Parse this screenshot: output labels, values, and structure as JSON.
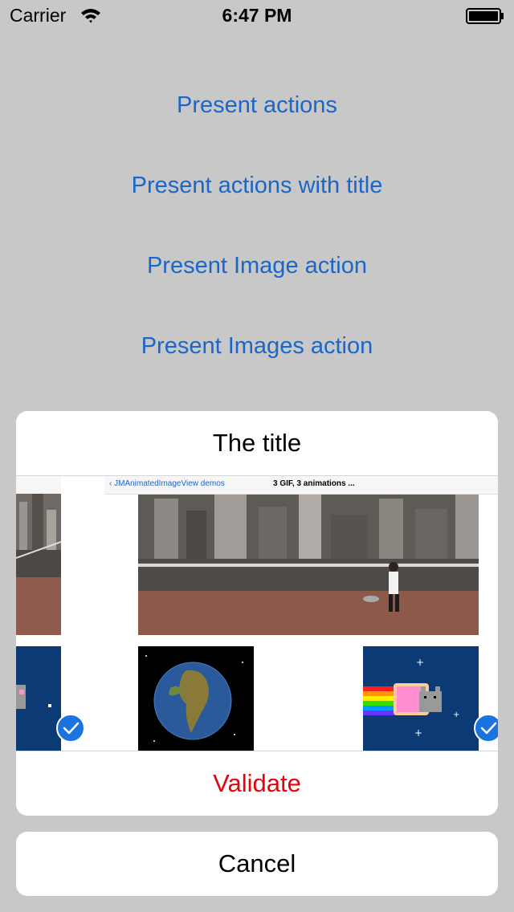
{
  "status_bar": {
    "carrier": "Carrier",
    "time": "6:47 PM",
    "wifi_icon": "wifi-icon",
    "battery_icon": "battery-icon"
  },
  "menu": {
    "present_actions": "Present actions",
    "present_actions_with_title": "Present actions with title",
    "present_image_action": "Present Image action",
    "present_images_action": "Present Images action"
  },
  "action_sheet": {
    "title": "The title",
    "validate_label": "Validate",
    "cancel_label": "Cancel",
    "images": {
      "screenshot": {
        "back_label": "JMAnimatedImageView demos",
        "nav_title": "3 GIF, 3 animations ..."
      },
      "selected_checks": 2
    }
  },
  "colors": {
    "background": "#c8c8c8",
    "link": "#1a66c9",
    "destructive": "#e3050d",
    "check": "#1b73e0"
  }
}
